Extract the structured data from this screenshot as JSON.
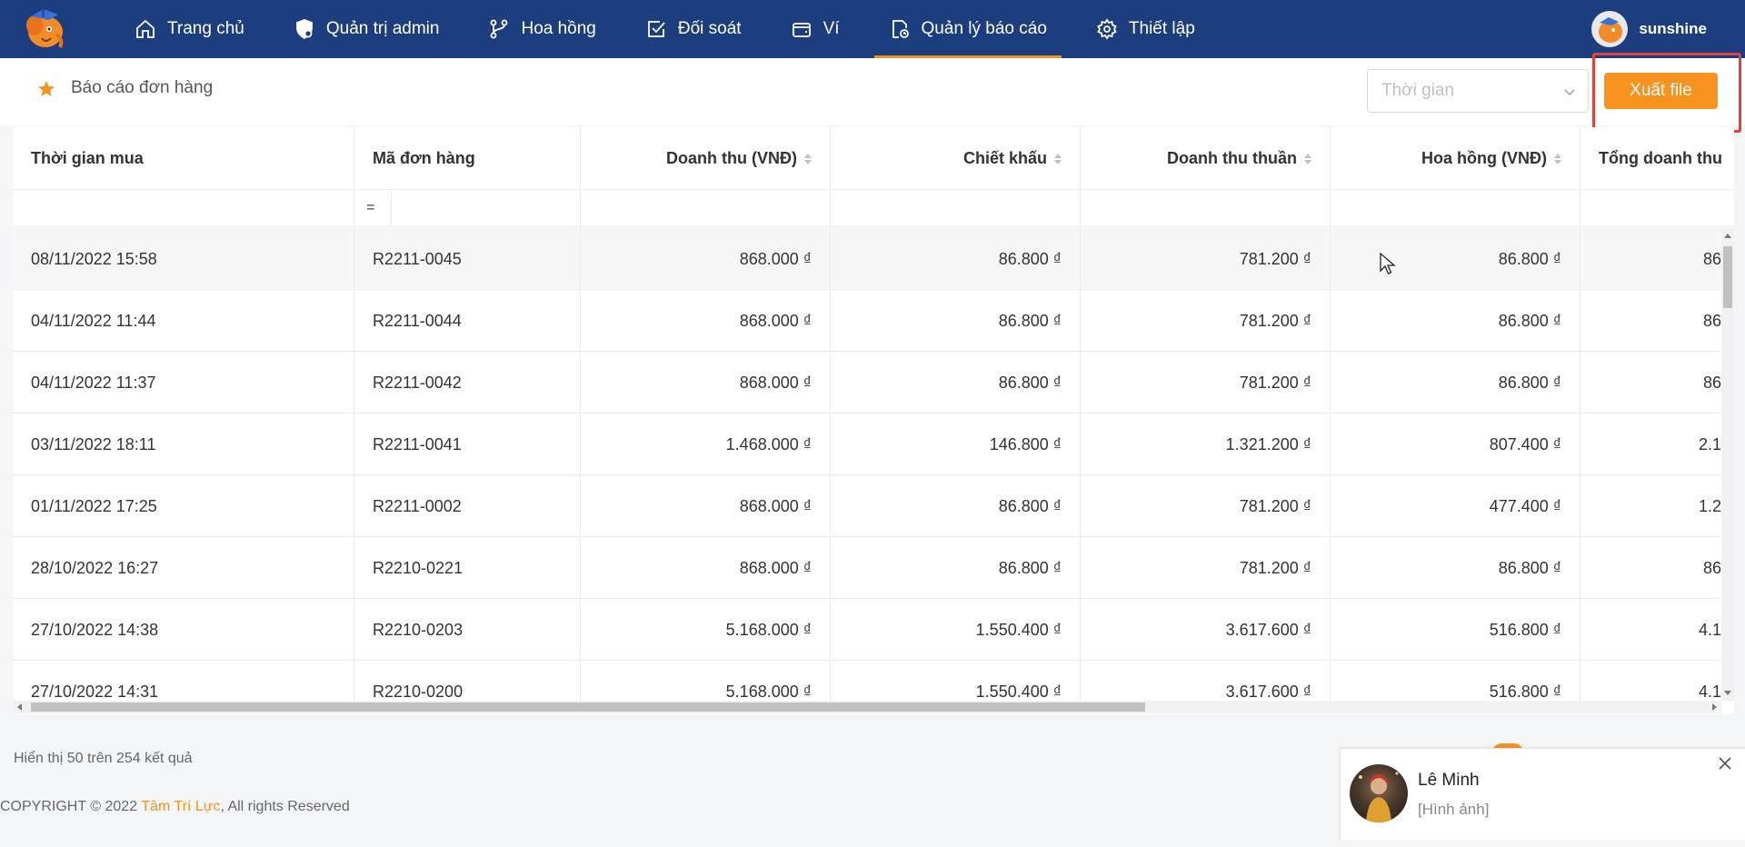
{
  "nav": {
    "items": [
      {
        "label": "Trang chủ",
        "icon": "home-icon"
      },
      {
        "label": "Quản trị admin",
        "icon": "shield-gear-icon"
      },
      {
        "label": "Hoa hồng",
        "icon": "branch-icon"
      },
      {
        "label": "Đối soát",
        "icon": "checkbox-icon"
      },
      {
        "label": "Ví",
        "icon": "wallet-icon"
      },
      {
        "label": "Quản lý báo cáo",
        "icon": "report-clock-icon",
        "active": true
      },
      {
        "label": "Thiết lập",
        "icon": "gear-icon"
      }
    ],
    "username": "sunshine"
  },
  "header": {
    "title": "Báo cáo đơn hàng",
    "time_placeholder": "Thời gian",
    "export_label": "Xuất file"
  },
  "table": {
    "columns": [
      "Thời gian mua",
      "Mã đơn hàng",
      "Doanh thu (VNĐ)",
      "Chiết khấu",
      "Doanh thu thuần",
      "Hoa hồng (VNĐ)",
      "Tổng doanh thu"
    ],
    "filter_operator": "=",
    "rows": [
      {
        "time": "08/11/2022 15:58",
        "code": "R2211-0045",
        "revenue": "868.000 ₫",
        "discount": "86.800 ₫",
        "net": "781.200 ₫",
        "commission": "86.800 ₫",
        "total": "86"
      },
      {
        "time": "04/11/2022 11:44",
        "code": "R2211-0044",
        "revenue": "868.000 ₫",
        "discount": "86.800 ₫",
        "net": "781.200 ₫",
        "commission": "86.800 ₫",
        "total": "86"
      },
      {
        "time": "04/11/2022 11:37",
        "code": "R2211-0042",
        "revenue": "868.000 ₫",
        "discount": "86.800 ₫",
        "net": "781.200 ₫",
        "commission": "86.800 ₫",
        "total": "86"
      },
      {
        "time": "03/11/2022 18:11",
        "code": "R2211-0041",
        "revenue": "1.468.000 ₫",
        "discount": "146.800 ₫",
        "net": "1.321.200 ₫",
        "commission": "807.400 ₫",
        "total": "2.1"
      },
      {
        "time": "01/11/2022 17:25",
        "code": "R2211-0002",
        "revenue": "868.000 ₫",
        "discount": "86.800 ₫",
        "net": "781.200 ₫",
        "commission": "477.400 ₫",
        "total": "1.2"
      },
      {
        "time": "28/10/2022 16:27",
        "code": "R2210-0221",
        "revenue": "868.000 ₫",
        "discount": "86.800 ₫",
        "net": "781.200 ₫",
        "commission": "86.800 ₫",
        "total": "86"
      },
      {
        "time": "27/10/2022 14:38",
        "code": "R2210-0203",
        "revenue": "5.168.000 ₫",
        "discount": "1.550.400 ₫",
        "net": "3.617.600 ₫",
        "commission": "516.800 ₫",
        "total": "4.1"
      },
      {
        "time": "27/10/2022 14:31",
        "code": "R2210-0200",
        "revenue": "5.168.000 ₫",
        "discount": "1.550.400 ₫",
        "net": "3.617.600 ₫",
        "commission": "516.800 ₫",
        "total": "4.1"
      }
    ]
  },
  "footer": {
    "result_text": "Hiển thị 50 trên 254 kết quả",
    "copyright_prefix": "COPYRIGHT © 2022 ",
    "copyright_brand": "Tâm Trí Lực",
    "copyright_suffix": ", All rights Reserved"
  },
  "chat": {
    "name": "Lê Minh",
    "message": "[Hình ảnh]"
  },
  "colors": {
    "nav_bg": "#1d3e7e",
    "accent": "#f7931e",
    "highlight": "#e0413b"
  }
}
